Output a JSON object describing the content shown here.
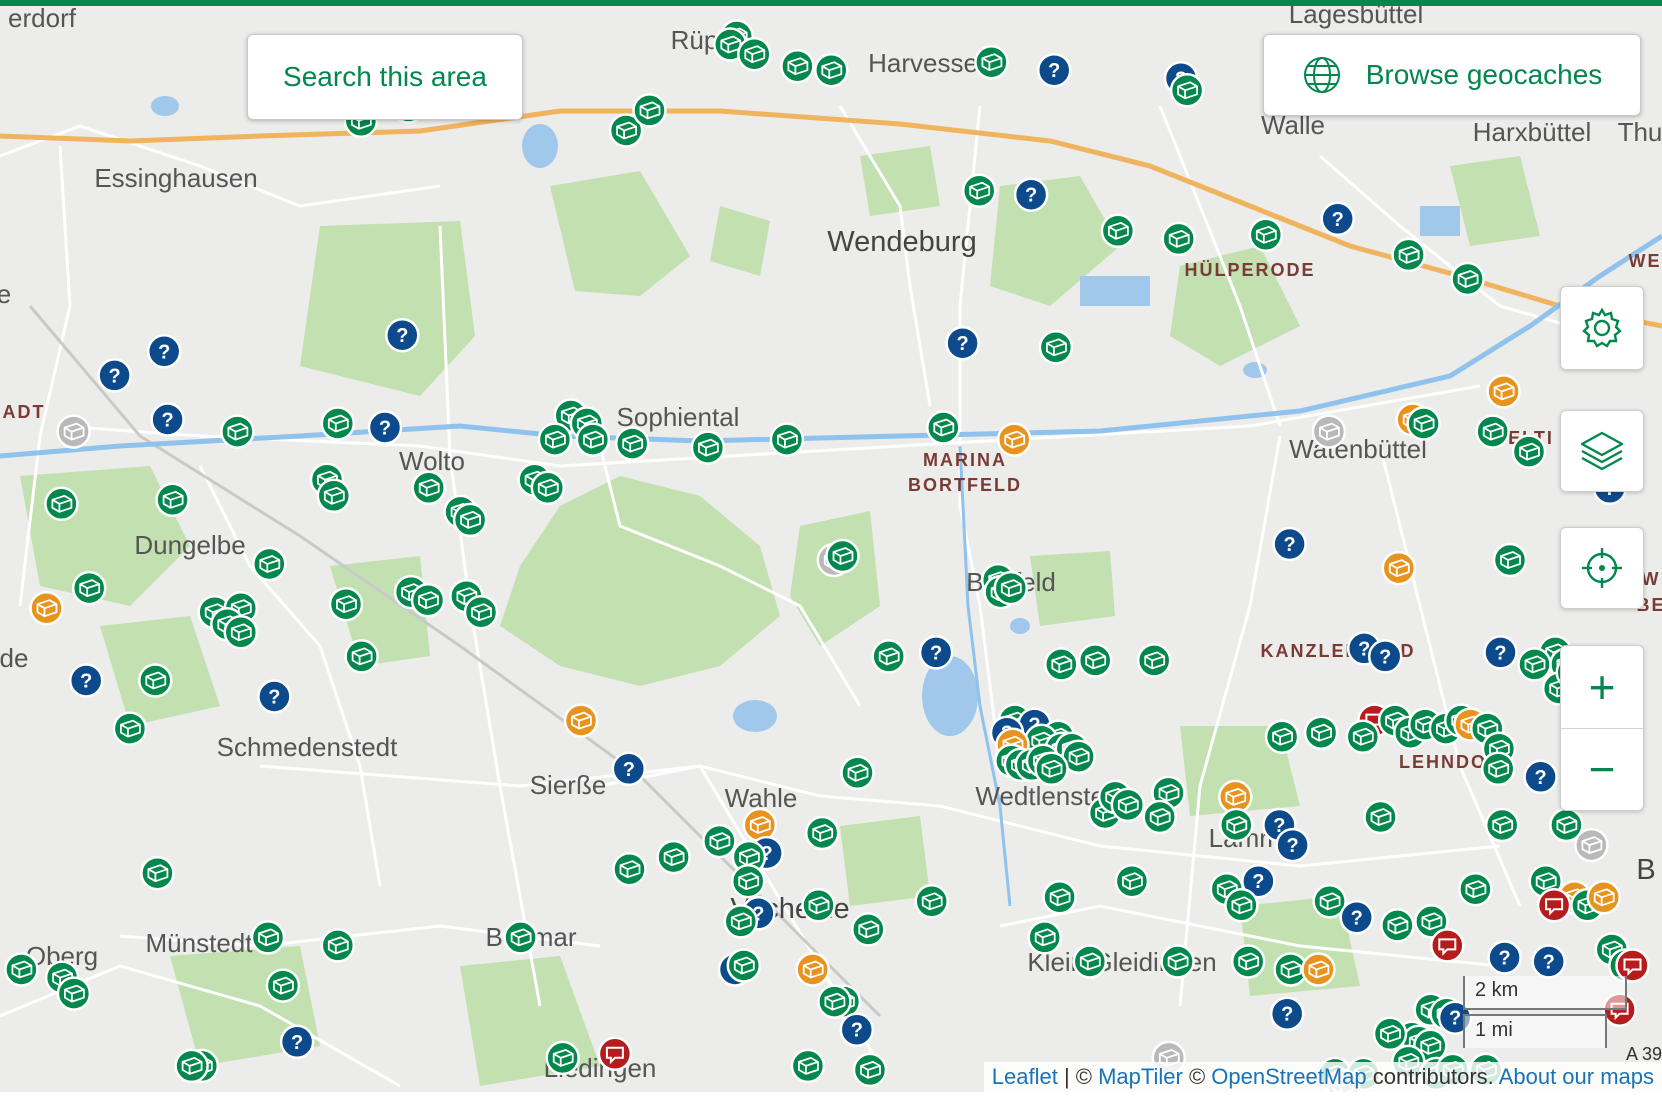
{
  "search_button": {
    "label": "Search this area"
  },
  "browse_button": {
    "label": "Browse geocaches"
  },
  "controls": {
    "settings": "gear-icon",
    "layers": "layers-icon",
    "locate": "crosshair-icon",
    "zoom_in": "+",
    "zoom_out": "−"
  },
  "scale": {
    "km": "2 km",
    "mi": "1 mi"
  },
  "attribution": {
    "leaflet": "Leaflet",
    "sep1": " | © ",
    "maptiler": "MapTiler",
    "sep2": " © ",
    "osm": "OpenStreetMap",
    "contributors": " contributors. ",
    "about": "About our maps"
  },
  "colors": {
    "brand": "#02874d",
    "traditional": "#02874d",
    "mystery": "#0c4a8c",
    "multi": "#e8931e",
    "event": "#b71c1c",
    "disabled": "#b9b9b9"
  },
  "places": [
    "erdorf",
    "Rüper",
    "Harvesse",
    "Lagesbüttel",
    "Essinghausen",
    "Walle",
    "Harxbüttel",
    "Thu",
    "Wendeburg",
    "HÜLPERODE",
    "WE",
    "e",
    "ADT",
    "Sophiental",
    "MARINA",
    "BORTFELD",
    "Wolto",
    "Watenbüttel",
    "VELTI",
    "Dungelbe",
    "Bortfeld",
    "W",
    "BE",
    "KANZLERFELD",
    "de",
    "LEHNDORF",
    "Schmedenstedt",
    "Sierße",
    "Wahle",
    "Wedtlenstedt",
    "Lamme",
    "B",
    "Vechelde",
    "Oberg",
    "Münstedt",
    "Bettmar",
    "Klein Gleidingen",
    "Liedingen",
    "A 39"
  ],
  "cache_markers": [
    {
      "type": "traditional",
      "lat": 52.3862,
      "lon": 10.2172
    },
    {
      "type": "traditional",
      "lat": 52.3852,
      "lon": 10.2153
    },
    {
      "type": "traditional",
      "lat": 52.384,
      "lon": 10.2224
    },
    {
      "type": "traditional",
      "lat": 52.3825,
      "lon": 10.2351
    },
    {
      "type": "traditional",
      "lat": 52.382,
      "lon": 10.2451
    },
    {
      "type": "traditional",
      "lat": 52.383,
      "lon": 10.2923
    },
    {
      "type": "mystery",
      "lat": 52.382,
      "lon": 10.3108
    },
    {
      "type": "mystery",
      "lat": 52.381,
      "lon": 10.3482
    },
    {
      "type": "traditional",
      "lat": 52.3795,
      "lon": 10.35
    },
    {
      "type": "traditional",
      "lat": 52.3805,
      "lon": 10.1397
    },
    {
      "type": "mystery",
      "lat": 52.3795,
      "lon": 10.1378
    },
    {
      "type": "traditional",
      "lat": 52.3775,
      "lon": 10.1204
    },
    {
      "type": "traditional",
      "lat": 52.3757,
      "lon": 10.1064
    },
    {
      "type": "traditional",
      "lat": 52.3745,
      "lon": 10.1846
    },
    {
      "type": "traditional",
      "lat": 52.377,
      "lon": 10.1915
    },
    {
      "type": "traditional",
      "lat": 52.367,
      "lon": 10.2887
    },
    {
      "type": "mystery",
      "lat": 52.3665,
      "lon": 10.304
    },
    {
      "type": "mystery",
      "lat": 52.3635,
      "lon": 10.3944
    },
    {
      "type": "traditional",
      "lat": 52.362,
      "lon": 10.3296
    },
    {
      "type": "traditional",
      "lat": 52.361,
      "lon": 10.3475
    },
    {
      "type": "traditional",
      "lat": 52.3615,
      "lon": 10.3732
    },
    {
      "type": "traditional",
      "lat": 52.359,
      "lon": 10.4153
    },
    {
      "type": "mystery",
      "lat": 52.349,
      "lon": 10.1186
    },
    {
      "type": "mystery",
      "lat": 52.347,
      "lon": 10.0484
    },
    {
      "type": "mystery",
      "lat": 52.344,
      "lon": 10.0338
    },
    {
      "type": "mystery",
      "lat": 52.348,
      "lon": 10.2838
    },
    {
      "type": "traditional",
      "lat": 52.3475,
      "lon": 10.3113
    },
    {
      "type": "traditional",
      "lat": 52.356,
      "lon": 10.4327
    },
    {
      "type": "multi",
      "lat": 52.342,
      "lon": 10.4433
    },
    {
      "type": "mystery",
      "lat": 52.3385,
      "lon": 10.0494
    },
    {
      "type": "mystery",
      "lat": 52.3375,
      "lon": 10.1135
    },
    {
      "type": "traditional",
      "lat": 52.337,
      "lon": 10.07
    },
    {
      "type": "traditional",
      "lat": 52.338,
      "lon": 10.0996
    },
    {
      "type": "disabled",
      "lat": 52.337,
      "lon": 10.0217
    },
    {
      "type": "traditional",
      "lat": 52.339,
      "lon": 10.1683
    },
    {
      "type": "traditional",
      "lat": 52.336,
      "lon": 10.1636
    },
    {
      "type": "traditional",
      "lat": 52.338,
      "lon": 10.173
    },
    {
      "type": "traditional",
      "lat": 52.336,
      "lon": 10.1748
    },
    {
      "type": "traditional",
      "lat": 52.3355,
      "lon": 10.1864
    },
    {
      "type": "traditional",
      "lat": 52.335,
      "lon": 10.2087
    },
    {
      "type": "traditional",
      "lat": 52.336,
      "lon": 10.232
    },
    {
      "type": "traditional",
      "lat": 52.3375,
      "lon": 10.2781
    },
    {
      "type": "multi",
      "lat": 52.336,
      "lon": 10.299
    },
    {
      "type": "disabled",
      "lat": 52.337,
      "lon": 10.3918
    },
    {
      "type": "multi",
      "lat": 52.3385,
      "lon": 10.4165
    },
    {
      "type": "traditional",
      "lat": 52.338,
      "lon": 10.4197
    },
    {
      "type": "traditional",
      "lat": 52.337,
      "lon": 10.4401
    },
    {
      "type": "traditional",
      "lat": 52.3345,
      "lon": 10.4508
    },
    {
      "type": "mystery",
      "lat": 52.33,
      "lon": 10.4746
    },
    {
      "type": "traditional",
      "lat": 52.328,
      "lon": 10.0181
    },
    {
      "type": "traditional",
      "lat": 52.3285,
      "lon": 10.0509
    },
    {
      "type": "traditional",
      "lat": 52.331,
      "lon": 10.0964
    },
    {
      "type": "traditional",
      "lat": 52.329,
      "lon": 10.0984
    },
    {
      "type": "traditional",
      "lat": 52.33,
      "lon": 10.1264
    },
    {
      "type": "traditional",
      "lat": 52.331,
      "lon": 10.1576
    },
    {
      "type": "traditional",
      "lat": 52.33,
      "lon": 10.1615
    },
    {
      "type": "traditional",
      "lat": 52.327,
      "lon": 10.1358
    },
    {
      "type": "traditional",
      "lat": 52.326,
      "lon": 10.1386
    },
    {
      "type": "disabled",
      "lat": 52.321,
      "lon": 10.2458
    },
    {
      "type": "traditional",
      "lat": 52.3215,
      "lon": 10.2484
    },
    {
      "type": "mystery",
      "lat": 52.323,
      "lon": 10.3802
    },
    {
      "type": "multi",
      "lat": 52.32,
      "lon": 10.4124
    },
    {
      "type": "traditional",
      "lat": 52.321,
      "lon": 10.4452
    },
    {
      "type": "traditional",
      "lat": 52.3185,
      "lon": 10.2943
    },
    {
      "type": "traditional",
      "lat": 52.317,
      "lon": 10.295
    },
    {
      "type": "traditional",
      "lat": 52.3175,
      "lon": 10.298
    },
    {
      "type": "traditional",
      "lat": 52.3205,
      "lon": 10.0794
    },
    {
      "type": "traditional",
      "lat": 52.3175,
      "lon": 10.0263
    },
    {
      "type": "multi",
      "lat": 52.315,
      "lon": 10.0137
    },
    {
      "type": "traditional",
      "lat": 52.3155,
      "lon": 10.102
    },
    {
      "type": "traditional",
      "lat": 52.317,
      "lon": 10.1212
    },
    {
      "type": "traditional",
      "lat": 52.316,
      "lon": 10.1262
    },
    {
      "type": "traditional",
      "lat": 52.3165,
      "lon": 10.1375
    },
    {
      "type": "traditional",
      "lat": 52.3145,
      "lon": 10.1418
    },
    {
      "type": "traditional",
      "lat": 52.3145,
      "lon": 10.0633
    },
    {
      "type": "traditional",
      "lat": 52.315,
      "lon": 10.071
    },
    {
      "type": "traditional",
      "lat": 52.313,
      "lon": 10.067
    },
    {
      "type": "traditional",
      "lat": 52.312,
      "lon": 10.071
    },
    {
      "type": "traditional",
      "lat": 52.309,
      "lon": 10.1066
    },
    {
      "type": "traditional",
      "lat": 52.309,
      "lon": 10.262
    },
    {
      "type": "mystery",
      "lat": 52.3095,
      "lon": 10.276
    },
    {
      "type": "traditional",
      "lat": 52.308,
      "lon": 10.3129
    },
    {
      "type": "traditional",
      "lat": 52.3085,
      "lon": 10.3229
    },
    {
      "type": "traditional",
      "lat": 52.3085,
      "lon": 10.3403
    },
    {
      "type": "mystery",
      "lat": 52.31,
      "lon": 10.4022
    },
    {
      "type": "mystery",
      "lat": 52.309,
      "lon": 10.4084
    },
    {
      "type": "mystery",
      "lat": 52.3095,
      "lon": 10.4424
    },
    {
      "type": "traditional",
      "lat": 52.3095,
      "lon": 10.4585
    },
    {
      "type": "traditional",
      "lat": 52.308,
      "lon": 10.4618
    },
    {
      "type": "traditional",
      "lat": 52.305,
      "lon": 10.4597
    },
    {
      "type": "traditional",
      "lat": 52.307,
      "lon": 10.4637
    },
    {
      "type": "traditional",
      "lat": 52.308,
      "lon": 10.4524
    },
    {
      "type": "mystery",
      "lat": 52.306,
      "lon": 10.4788
    },
    {
      "type": "traditional",
      "lat": 52.305,
      "lon": 10.476
    },
    {
      "type": "mystery",
      "lat": 52.306,
      "lon": 10.0254
    },
    {
      "type": "traditional",
      "lat": 52.306,
      "lon": 10.0458
    },
    {
      "type": "mystery",
      "lat": 52.304,
      "lon": 10.0809
    },
    {
      "type": "traditional",
      "lat": 52.3,
      "lon": 10.0383
    },
    {
      "type": "event",
      "lat": 52.301,
      "lon": 10.4052
    },
    {
      "type": "traditional",
      "lat": 52.301,
      "lon": 10.2992
    },
    {
      "type": "mystery",
      "lat": 52.3005,
      "lon": 10.305
    },
    {
      "type": "traditional",
      "lat": 52.299,
      "lon": 10.312
    },
    {
      "type": "traditional",
      "lat": 52.2985,
      "lon": 10.307
    },
    {
      "type": "traditional",
      "lat": 52.2975,
      "lon": 10.313
    },
    {
      "type": "traditional",
      "lat": 52.2975,
      "lon": 10.316
    },
    {
      "type": "traditional",
      "lat": 52.2965,
      "lon": 10.318
    },
    {
      "type": "mystery",
      "lat": 52.2995,
      "lon": 10.2969
    },
    {
      "type": "multi",
      "lat": 52.298,
      "lon": 10.2985
    },
    {
      "type": "traditional",
      "lat": 52.296,
      "lon": 10.2982
    },
    {
      "type": "traditional",
      "lat": 52.2955,
      "lon": 10.301
    },
    {
      "type": "traditional",
      "lat": 52.2955,
      "lon": 10.3042
    },
    {
      "type": "traditional",
      "lat": 52.296,
      "lon": 10.3075
    },
    {
      "type": "traditional",
      "lat": 52.295,
      "lon": 10.31
    },
    {
      "type": "multi",
      "lat": 52.301,
      "lon": 10.1713
    },
    {
      "type": "mystery",
      "lat": 52.295,
      "lon": 10.1854
    },
    {
      "type": "traditional",
      "lat": 52.2945,
      "lon": 10.2528
    },
    {
      "type": "traditional",
      "lat": 52.299,
      "lon": 10.378
    },
    {
      "type": "traditional",
      "lat": 52.2995,
      "lon": 10.3895
    },
    {
      "type": "traditional",
      "lat": 52.299,
      "lon": 10.4018
    },
    {
      "type": "traditional",
      "lat": 52.301,
      "lon": 10.4113
    },
    {
      "type": "traditional",
      "lat": 52.2995,
      "lon": 10.4158
    },
    {
      "type": "traditional",
      "lat": 52.3005,
      "lon": 10.4202
    },
    {
      "type": "traditional",
      "lat": 52.3,
      "lon": 10.4263
    },
    {
      "type": "traditional",
      "lat": 52.301,
      "lon": 10.4308
    },
    {
      "type": "multi",
      "lat": 52.3005,
      "lon": 10.4335
    },
    {
      "type": "traditional",
      "lat": 52.3,
      "lon": 10.4385
    },
    {
      "type": "traditional",
      "lat": 52.2975,
      "lon": 10.4419
    },
    {
      "type": "traditional",
      "lat": 52.295,
      "lon": 10.4417
    },
    {
      "type": "mystery",
      "lat": 52.294,
      "lon": 10.4542
    },
    {
      "type": "traditional",
      "lat": 52.294,
      "lon": 10.469
    },
    {
      "type": "traditional",
      "lat": 52.292,
      "lon": 10.4774
    },
    {
      "type": "traditional",
      "lat": 52.289,
      "lon": 10.407
    },
    {
      "type": "traditional",
      "lat": 52.292,
      "lon": 10.3445
    },
    {
      "type": "traditional",
      "lat": 52.2895,
      "lon": 10.3258
    },
    {
      "type": "traditional",
      "lat": 52.2915,
      "lon": 10.3288
    },
    {
      "type": "traditional",
      "lat": 52.2905,
      "lon": 10.3325
    },
    {
      "type": "traditional",
      "lat": 52.289,
      "lon": 10.3419
    },
    {
      "type": "multi",
      "lat": 52.2915,
      "lon": 10.3642
    },
    {
      "type": "traditional",
      "lat": 52.288,
      "lon": 10.3645
    },
    {
      "type": "mystery",
      "lat": 52.288,
      "lon": 10.3772
    },
    {
      "type": "mystery",
      "lat": 52.2855,
      "lon": 10.3811
    },
    {
      "type": "traditional",
      "lat": 52.288,
      "lon": 10.4429
    },
    {
      "type": "traditional",
      "lat": 52.288,
      "lon": 10.4618
    },
    {
      "type": "disabled",
      "lat": 52.2855,
      "lon": 10.4692
    },
    {
      "type": "multi",
      "lat": 52.288,
      "lon": 10.224
    },
    {
      "type": "traditional",
      "lat": 52.287,
      "lon": 10.2424
    },
    {
      "type": "traditional",
      "lat": 52.286,
      "lon": 10.2121
    },
    {
      "type": "mystery",
      "lat": 52.2845,
      "lon": 10.226
    },
    {
      "type": "traditional",
      "lat": 52.284,
      "lon": 10.1986
    },
    {
      "type": "traditional",
      "lat": 52.284,
      "lon": 10.2208
    },
    {
      "type": "traditional",
      "lat": 52.2825,
      "lon": 10.1856
    },
    {
      "type": "traditional",
      "lat": 52.281,
      "lon": 10.2206
    },
    {
      "type": "traditional",
      "lat": 52.281,
      "lon": 10.3337
    },
    {
      "type": "mystery",
      "lat": 52.281,
      "lon": 10.371
    },
    {
      "type": "traditional",
      "lat": 52.28,
      "lon": 10.435
    },
    {
      "type": "traditional",
      "lat": 52.281,
      "lon": 10.4557
    },
    {
      "type": "multi",
      "lat": 52.279,
      "lon": 10.4642
    },
    {
      "type": "traditional",
      "lat": 52.282,
      "lon": 10.0464
    },
    {
      "type": "traditional",
      "lat": 52.278,
      "lon": 10.2413
    },
    {
      "type": "traditional",
      "lat": 52.2785,
      "lon": 10.2747
    },
    {
      "type": "traditional",
      "lat": 52.279,
      "lon": 10.3124
    },
    {
      "type": "traditional",
      "lat": 52.28,
      "lon": 10.3617
    },
    {
      "type": "traditional",
      "lat": 52.278,
      "lon": 10.366
    },
    {
      "type": "traditional",
      "lat": 52.2785,
      "lon": 10.392
    },
    {
      "type": "event",
      "lat": 52.278,
      "lon": 10.4582
    },
    {
      "type": "traditional",
      "lat": 52.278,
      "lon": 10.468
    },
    {
      "type": "multi",
      "lat": 52.279,
      "lon": 10.4728
    },
    {
      "type": "mystery",
      "lat": 52.2765,
      "lon": 10.4
    },
    {
      "type": "traditional",
      "lat": 52.2755,
      "lon": 10.412
    },
    {
      "type": "traditional",
      "lat": 52.276,
      "lon": 10.422
    },
    {
      "type": "mystery",
      "lat": 52.277,
      "lon": 10.2236
    },
    {
      "type": "traditional",
      "lat": 52.276,
      "lon": 10.2184
    },
    {
      "type": "traditional",
      "lat": 52.275,
      "lon": 10.256
    },
    {
      "type": "traditional",
      "lat": 52.274,
      "lon": 10.308
    },
    {
      "type": "traditional",
      "lat": 52.274,
      "lon": 10.1535
    },
    {
      "type": "traditional",
      "lat": 52.274,
      "lon": 10.079
    },
    {
      "type": "traditional",
      "lat": 52.273,
      "lon": 10.0996
    },
    {
      "type": "event",
      "lat": 52.273,
      "lon": 10.4267
    },
    {
      "type": "mystery",
      "lat": 52.2715,
      "lon": 10.4436
    },
    {
      "type": "mystery",
      "lat": 52.271,
      "lon": 10.4566
    },
    {
      "type": "traditional",
      "lat": 52.2725,
      "lon": 10.4752
    },
    {
      "type": "traditional",
      "lat": 52.2705,
      "lon": 10.4792
    },
    {
      "type": "event",
      "lat": 52.2705,
      "lon": 10.4813
    },
    {
      "type": "mystery",
      "lat": 52.27,
      "lon": 10.2167
    },
    {
      "type": "traditional",
      "lat": 52.2705,
      "lon": 10.2193
    },
    {
      "type": "multi",
      "lat": 52.27,
      "lon": 10.2396
    },
    {
      "type": "traditional",
      "lat": 52.271,
      "lon": 10.3213
    },
    {
      "type": "traditional",
      "lat": 52.271,
      "lon": 10.3472
    },
    {
      "type": "traditional",
      "lat": 52.271,
      "lon": 10.368
    },
    {
      "type": "traditional",
      "lat": 52.27,
      "lon": 10.3805
    },
    {
      "type": "multi",
      "lat": 52.27,
      "lon": 10.3887
    },
    {
      "type": "traditional",
      "lat": 52.27,
      "lon": 10.0063
    },
    {
      "type": "traditional",
      "lat": 52.269,
      "lon": 10.0183
    },
    {
      "type": "traditional",
      "lat": 52.267,
      "lon": 10.0218
    },
    {
      "type": "traditional",
      "lat": 52.268,
      "lon": 10.0834
    },
    {
      "type": "traditional",
      "lat": 52.266,
      "lon": 10.2488
    },
    {
      "type": "traditional",
      "lat": 52.266,
      "lon": 10.246
    },
    {
      "type": "traditional",
      "lat": 52.265,
      "lon": 10.4218
    },
    {
      "type": "traditional",
      "lat": 52.2645,
      "lon": 10.4265
    },
    {
      "type": "mystery",
      "lat": 52.2645,
      "lon": 10.3795
    },
    {
      "type": "mystery",
      "lat": 52.264,
      "lon": 10.429
    },
    {
      "type": "event",
      "lat": 52.265,
      "lon": 10.4775
    },
    {
      "type": "mystery",
      "lat": 52.2625,
      "lon": 10.2526
    },
    {
      "type": "traditional",
      "lat": 52.2615,
      "lon": 10.4163
    },
    {
      "type": "traditional",
      "lat": 52.261,
      "lon": 10.4183
    },
    {
      "type": "traditional",
      "lat": 52.2605,
      "lon": 10.4217
    },
    {
      "type": "traditional",
      "lat": 52.262,
      "lon": 10.4098
    },
    {
      "type": "mystery",
      "lat": 52.261,
      "lon": 10.0876
    },
    {
      "type": "traditional",
      "lat": 52.259,
      "lon": 10.1659
    },
    {
      "type": "traditional",
      "lat": 52.258,
      "lon": 10.0595
    },
    {
      "type": "traditional",
      "lat": 52.258,
      "lon": 10.0565
    },
    {
      "type": "disabled",
      "lat": 52.259,
      "lon": 10.3446
    },
    {
      "type": "event",
      "lat": 52.2595,
      "lon": 10.1813
    },
    {
      "type": "traditional",
      "lat": 52.258,
      "lon": 10.2382
    },
    {
      "type": "traditional",
      "lat": 52.2575,
      "lon": 10.2565
    },
    {
      "type": "traditional",
      "lat": 52.257,
      "lon": 10.3936
    },
    {
      "type": "traditional",
      "lat": 52.2585,
      "lon": 10.4152
    },
    {
      "type": "traditional",
      "lat": 52.257,
      "lon": 10.402
    },
    {
      "type": "traditional",
      "lat": 52.257,
      "lon": 10.4235
    },
    {
      "type": "traditional",
      "lat": 52.2575,
      "lon": 10.4283
    },
    {
      "type": "traditional",
      "lat": 52.2575,
      "lon": 10.4381
    },
    {
      "type": "disabled",
      "lat": 52.2555,
      "lon": 10.396
    }
  ]
}
